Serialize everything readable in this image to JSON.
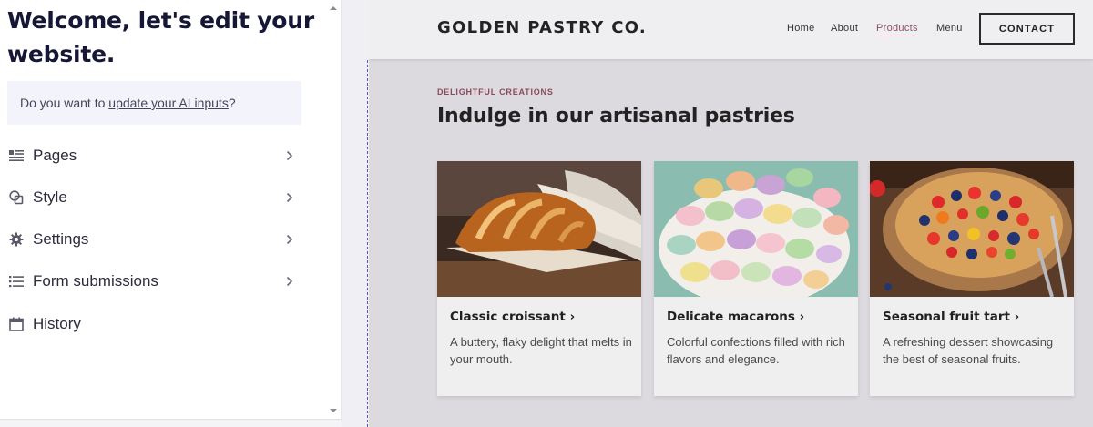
{
  "editor": {
    "welcome_title": "Welcome, let's edit your website.",
    "ai_prompt_prefix": "Do you want to ",
    "ai_prompt_link": "update your AI inputs",
    "ai_prompt_suffix": "?",
    "menu": [
      {
        "label": "Pages",
        "icon": "pages-icon",
        "has_chevron": true
      },
      {
        "label": "Style",
        "icon": "style-icon",
        "has_chevron": true
      },
      {
        "label": "Settings",
        "icon": "gear-icon",
        "has_chevron": true
      },
      {
        "label": "Form submissions",
        "icon": "list-icon",
        "has_chevron": true
      },
      {
        "label": "History",
        "icon": "calendar-icon",
        "has_chevron": false
      }
    ]
  },
  "site": {
    "brand": "GOLDEN PASTRY CO.",
    "nav": [
      {
        "label": "Home",
        "active": false
      },
      {
        "label": "About",
        "active": false
      },
      {
        "label": "Products",
        "active": true
      },
      {
        "label": "Menu",
        "active": false
      }
    ],
    "contact_button": "CONTACT",
    "eyebrow": "DELIGHTFUL CREATIONS",
    "heading": "Indulge in our artisanal pastries",
    "cards": [
      {
        "title": "Classic croissant",
        "description": "A buttery, flaky delight that melts in your mouth."
      },
      {
        "title": "Delicate macarons",
        "description": "Colorful confections filled with rich flavors and elegance."
      },
      {
        "title": "Seasonal fruit tart",
        "description": "A refreshing dessert showcasing the best of seasonal fruits."
      }
    ]
  },
  "colors": {
    "accent": "#8a5060",
    "selection_outline": "#5b4fd8",
    "panel_text": "#161636"
  }
}
